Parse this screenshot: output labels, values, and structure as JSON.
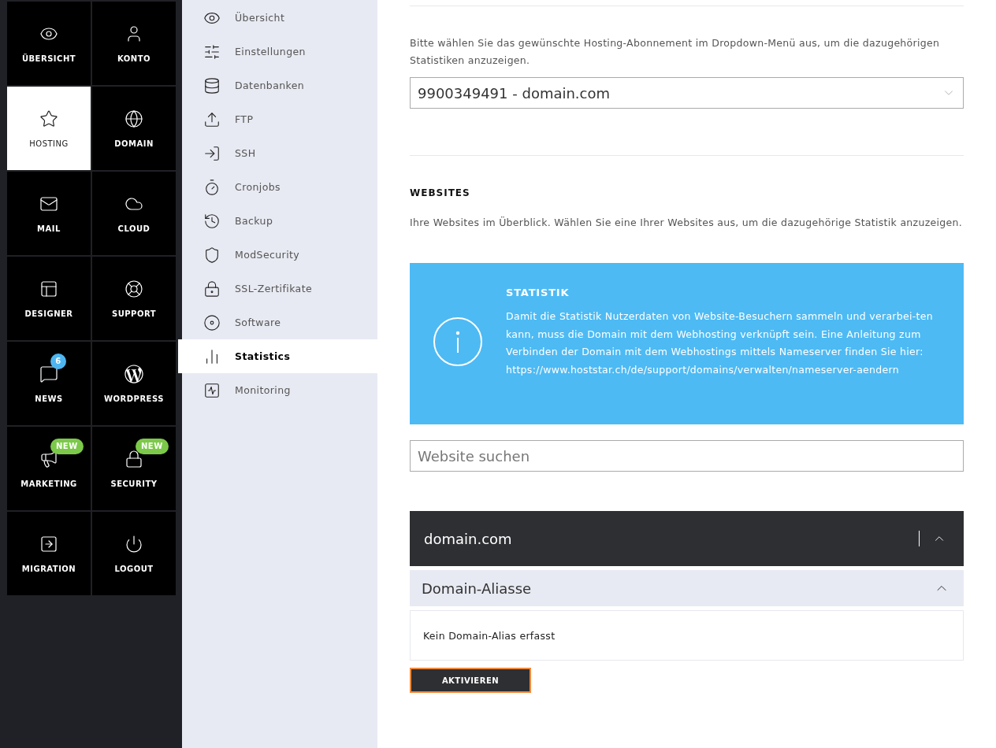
{
  "main_nav": [
    {
      "label": "ÜBERSICHT",
      "selected": false
    },
    {
      "label": "KONTO",
      "selected": false
    },
    {
      "label": "HOSTING",
      "selected": true
    },
    {
      "label": "DOMAIN",
      "selected": false
    },
    {
      "label": "MAIL",
      "selected": false
    },
    {
      "label": "CLOUD",
      "selected": false
    },
    {
      "label": "DESIGNER",
      "selected": false
    },
    {
      "label": "SUPPORT",
      "selected": false
    },
    {
      "label": "NEWS",
      "selected": false,
      "badge": {
        "text": "6",
        "kind": "count",
        "color": "#4db6f2"
      }
    },
    {
      "label": "WORDPRESS",
      "selected": false
    },
    {
      "label": "MARKETING",
      "selected": false,
      "badge": {
        "text": "NEW",
        "kind": "pill",
        "color": "#7cc94a"
      }
    },
    {
      "label": "SECURITY",
      "selected": false,
      "badge": {
        "text": "NEW",
        "kind": "pill",
        "color": "#7cc94a"
      }
    },
    {
      "label": "MIGRATION",
      "selected": false
    },
    {
      "label": "LOGOUT",
      "selected": false
    }
  ],
  "sub_nav": [
    {
      "label": "Übersicht",
      "selected": false
    },
    {
      "label": "Einstellungen",
      "selected": false
    },
    {
      "label": "Datenbanken",
      "selected": false
    },
    {
      "label": "FTP",
      "selected": false
    },
    {
      "label": "SSH",
      "selected": false
    },
    {
      "label": "Cronjobs",
      "selected": false
    },
    {
      "label": "Backup",
      "selected": false
    },
    {
      "label": "ModSecurity",
      "selected": false
    },
    {
      "label": "SSL-Zertifikate",
      "selected": false
    },
    {
      "label": "Software",
      "selected": false
    },
    {
      "label": "Statistics",
      "selected": true
    },
    {
      "label": "Monitoring",
      "selected": false
    }
  ],
  "subscription": {
    "hint": "Bitte wählen Sie das gewünschte Hosting-Abonnement im Dropdown-Menü aus, um die dazugehörigen Statistiken anzuzeigen.",
    "value": "9900349491 - domain.com"
  },
  "websites": {
    "heading": "WEBSITES",
    "description": "Ihre Websites im Überblick. Wählen Sie eine Ihrer Websites aus, um die dazugehörige Statistik anzuzeigen.",
    "info": {
      "title": "STATISTIK",
      "text": "Damit die Statistik Nutzerdaten von Website-Besuchern sammeln und verarbei-ten kann, muss die Domain mit dem Webhosting verknüpft sein. Eine Anleitung zum Verbinden der Domain mit dem Webhostings mittels Nameserver finden Sie hier: https://www.hoststar.ch/de/support/domains/verwalten/nameserver-aendern"
    },
    "search": {
      "placeholder": "Website suchen"
    },
    "site": {
      "name": "domain.com",
      "expanded": true,
      "aliases": {
        "title": "Domain-Aliasse",
        "expanded": true,
        "empty_text": "Kein Domain-Alias erfasst"
      },
      "button": "AKTIVIEREN"
    }
  }
}
